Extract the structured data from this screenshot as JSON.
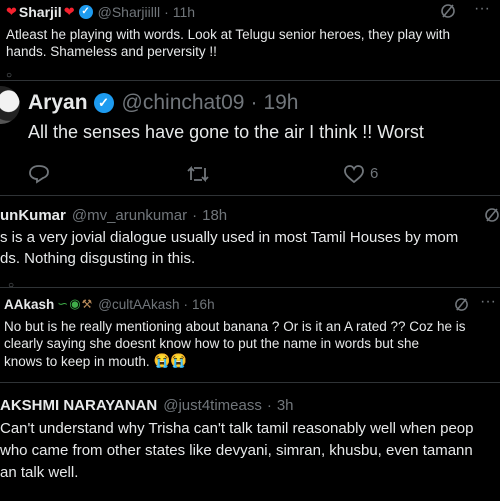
{
  "tweets": [
    {
      "name": "Sharjil",
      "handle": "@Sharjiilll",
      "time": "11h",
      "text_lines": [
        "Atleast he playing with words. Look at Telugu senior heroes, they play with",
        "hands. Shameless and perversity !!"
      ]
    },
    {
      "name": "Aryan",
      "handle": "@chinchat09",
      "time": "19h",
      "text_lines": [
        "All the senses have gone to the air I think !! Worst"
      ],
      "likes": "6"
    },
    {
      "name": "unKumar",
      "handle": "@mv_arunkumar",
      "time": "18h",
      "text_lines": [
        "s is a very jovial dialogue usually used in most Tamil Houses by mom",
        "ds. Nothing disgusting in this."
      ]
    },
    {
      "name": "AAkash",
      "handle": "@cultAAkash",
      "time": "16h",
      "text_lines": [
        "No but is he really mentioning about banana ? Or is it an A rated ?? Coz he is",
        "clearly saying she doesnt know how to put the name in words but she",
        "knows to keep in mouth."
      ],
      "emojis": "😭😭"
    },
    {
      "name": "AKSHMI NARAYANAN",
      "handle": "@just4timeass",
      "time": "3h",
      "text_lines": [
        "Can't understand why Trisha can't talk tamil reasonably well when peop",
        "who came from other states like devyani, simran, khusbu, even tamann",
        "an talk well."
      ]
    }
  ],
  "colors": {
    "accent": "#1d9bf0",
    "green": "#00ba7c",
    "muted": "#71767b",
    "text": "#e7e9ea"
  }
}
